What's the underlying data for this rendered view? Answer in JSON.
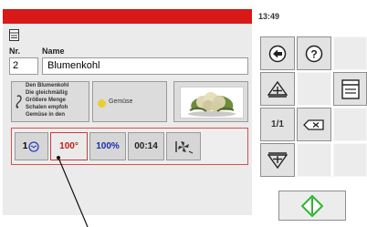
{
  "header": {
    "time": "13:49"
  },
  "form": {
    "nr_label": "Nr.",
    "name_label": "Name",
    "nr_value": "2",
    "name_value": "Blumenkohl"
  },
  "info": {
    "description_lines": [
      "Den Blumenkohl",
      "Die gleichmäßig",
      "Größere Menge",
      "Schalen empfoh",
      "Gemüse in den"
    ],
    "category": "Gemüse"
  },
  "step": {
    "mode": "1",
    "temperature": "100°",
    "humidity": "100%",
    "time": "00:14"
  },
  "nav": {
    "page_indicator": "1/1"
  },
  "colors": {
    "red_bar": "#d91818",
    "temperature_text": "#c41a1a",
    "humidity_text": "#1a2fb0",
    "start_icon": "#2fb52f"
  },
  "icons": [
    "document-icon",
    "description-icon",
    "category-dot-icon",
    "steam-icon",
    "fan-icon",
    "back-arrow-icon",
    "help-icon",
    "add-step-icon",
    "book-icon",
    "clear-icon",
    "remove-step-icon",
    "start-icon"
  ]
}
